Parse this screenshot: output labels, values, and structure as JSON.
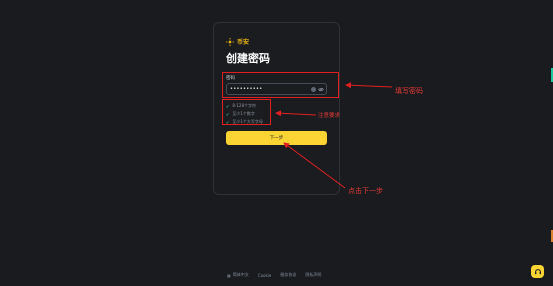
{
  "brand": {
    "name": "币安",
    "accent": "#f0b90b",
    "logo_icon": "binance-logo-icon"
  },
  "page": {
    "title": "创建密码"
  },
  "form": {
    "password_label": "密码",
    "password_value": "••••••••••",
    "clear_icon": "clear-icon",
    "eye_icon": "eye-icon",
    "requirements": [
      {
        "text": "8-128个字符",
        "icon": "check-icon"
      },
      {
        "text": "至少1个数字",
        "icon": "check-icon"
      },
      {
        "text": "至少1个大写字母",
        "icon": "check-icon"
      }
    ],
    "next_button": "下一步"
  },
  "annotations": {
    "fill_password": "填写密码",
    "note_requirements": "注意要求",
    "click_next": "点击下一步",
    "color": "#e02020"
  },
  "footer": {
    "language": "简体中文",
    "cookie": "Cookie",
    "terms": "服务协议",
    "privacy": "隐私声明"
  },
  "help": {
    "icon": "support-icon",
    "color": "#fcd535"
  }
}
